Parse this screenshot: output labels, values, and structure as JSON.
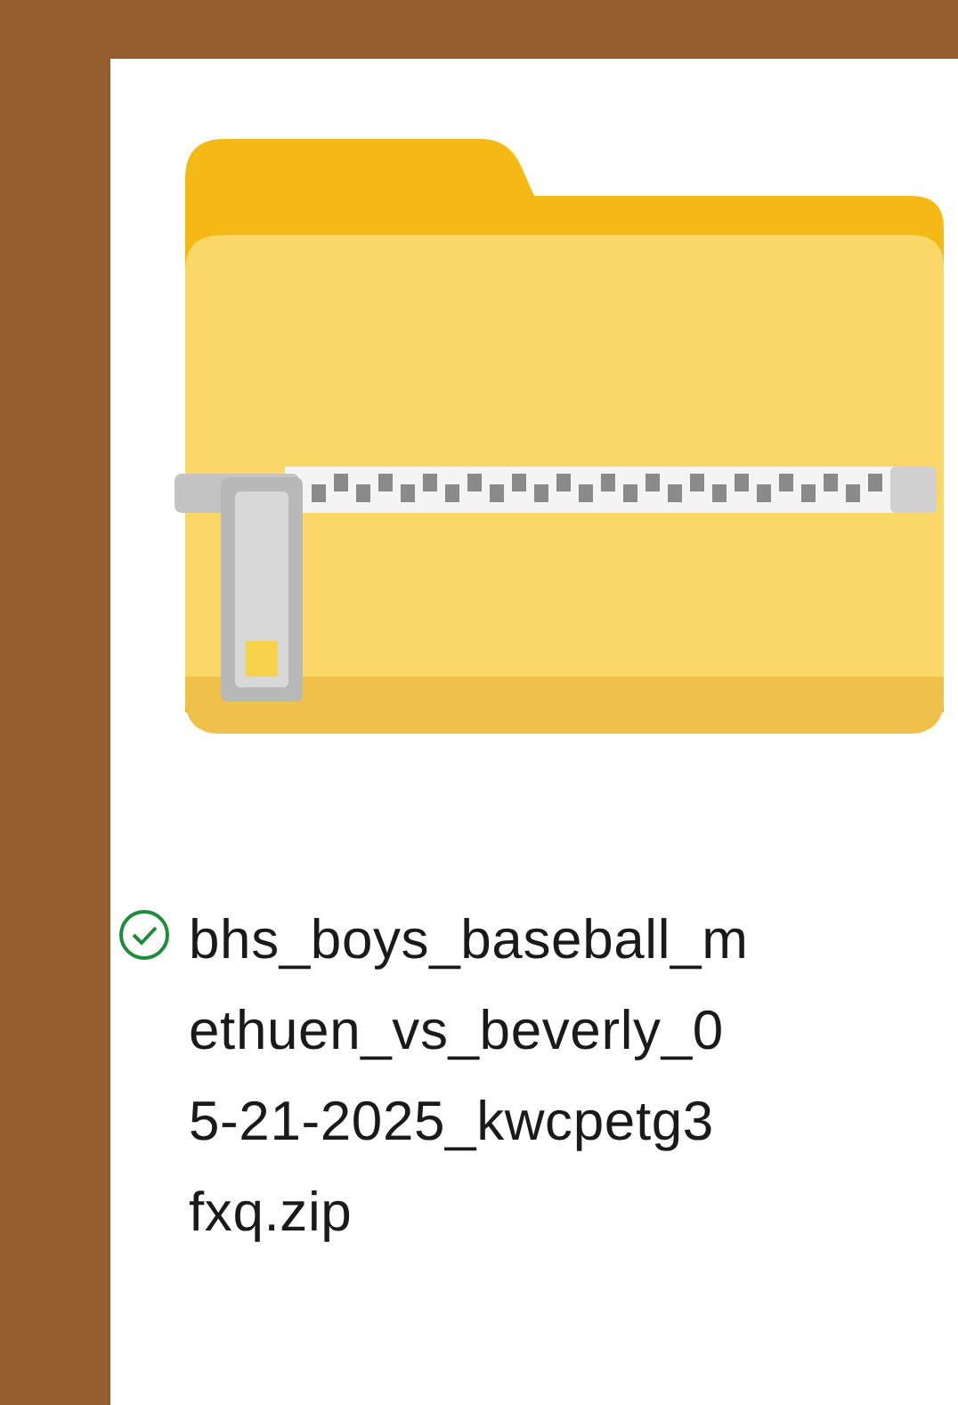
{
  "file": {
    "synced": true,
    "name_lines": [
      "bhs_boys_baseball_m",
      "ethuen_vs_beverly_0",
      "5-21-2025_kwcpetg3",
      "fxq.zip"
    ]
  }
}
